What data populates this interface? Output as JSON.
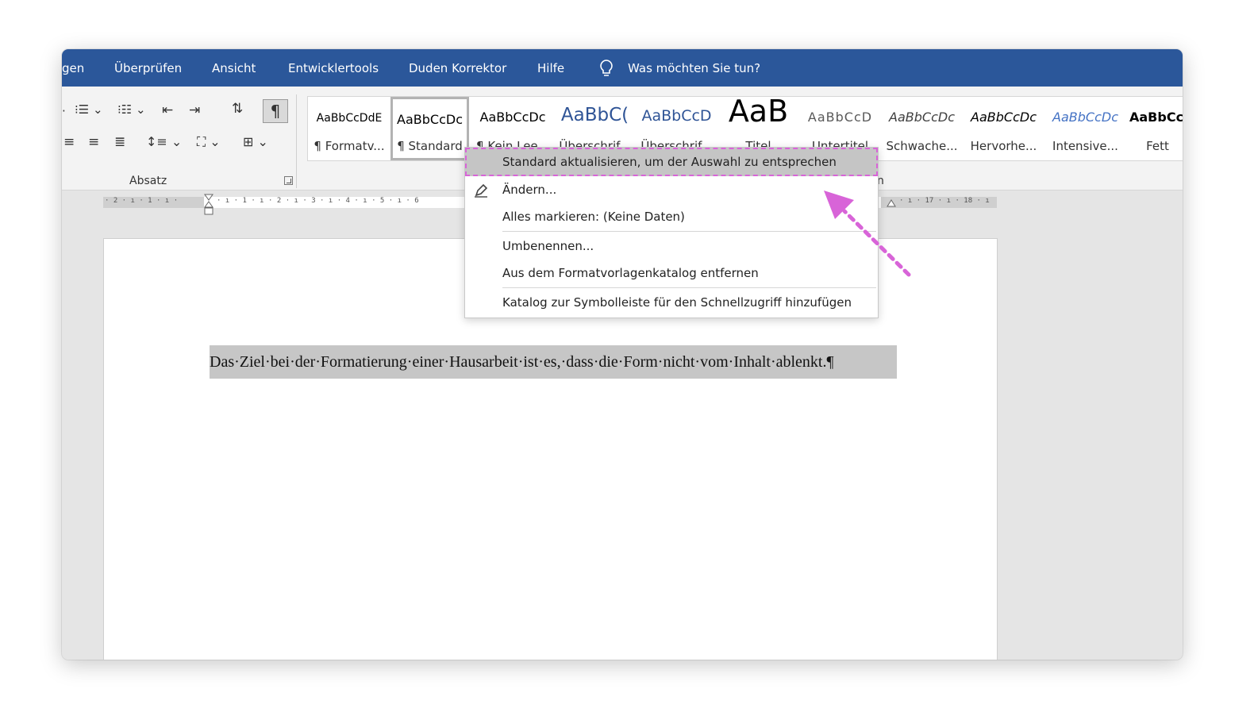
{
  "menubar": {
    "tabs": [
      "gen",
      "Überprüfen",
      "Ansicht",
      "Entwicklertools",
      "Duden Korrektor",
      "Hilfe"
    ],
    "tell_me": "Was möchten Sie tun?"
  },
  "ribbon": {
    "paragraph_group_label": "Absatz",
    "styles_group_label_fragment": "n",
    "pilcrow": "¶",
    "styles": [
      {
        "preview": "AaBbCcDdE",
        "name": "¶ Formatv..."
      },
      {
        "preview": "AaBbCcDc",
        "name": "¶ Standard"
      },
      {
        "preview": "AaBbCcDc",
        "name": "¶ Kein Lee..."
      },
      {
        "preview": "AaBbC(",
        "name": "Überschrif..."
      },
      {
        "preview": "AaBbCcD",
        "name": "Überschrif..."
      },
      {
        "preview": "AaB",
        "name": "Titel"
      },
      {
        "preview": "AaBbCcD",
        "name": "Untertitel"
      },
      {
        "preview": "AaBbCcDc",
        "name": "Schwache..."
      },
      {
        "preview": "AaBbCcDc",
        "name": "Hervorhe..."
      },
      {
        "preview": "AaBbCcDc",
        "name": "Intensive..."
      },
      {
        "preview": "AaBbCcl",
        "name": "Fett"
      }
    ]
  },
  "ruler": {
    "left_ticks": "· 2 · ı · 1 · ı ·",
    "main_ticks": "· ı · 1 · ı · 2 · ı · 3 · ı · 4 · ı · 5 · ı · 6",
    "right_ticks": "· ı · 17 · ı · 18 · ı"
  },
  "document": {
    "text": "Das·Ziel·bei·der·Formatierung·einer·Hausarbeit·ist·es,·dass·die·Form·nicht·vom·Inhalt·ablenkt.¶"
  },
  "context_menu": {
    "items": [
      "Standard aktualisieren, um der Auswahl zu entsprechen",
      "Ändern...",
      "Alles markieren: (Keine Daten)",
      "Umbenennen...",
      "Aus dem Formatvorlagenkatalog entfernen",
      "Katalog zur Symbolleiste für den Schnellzugriff hinzufügen"
    ]
  },
  "colors": {
    "accent": "#2b579a",
    "highlight_dash": "#d864d8",
    "arrow": "#d864d8"
  }
}
